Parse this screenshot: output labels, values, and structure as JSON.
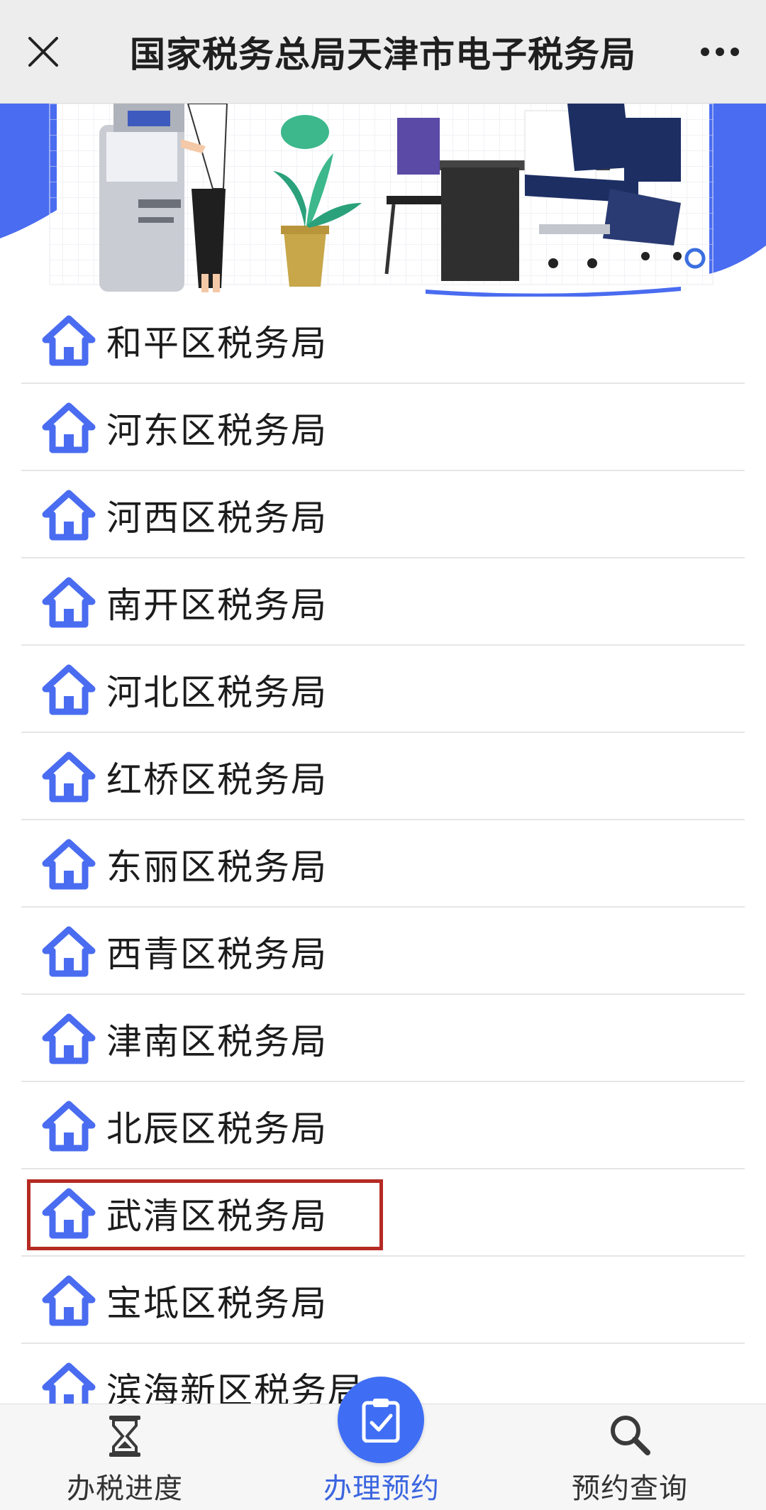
{
  "header": {
    "title": "国家税务总局天津市电子税务局",
    "close_icon": "close-icon",
    "more_icon": "more-dots-icon"
  },
  "banner": {
    "illustration": "tax-office-illustration"
  },
  "offices": [
    {
      "label": "和平区税务局"
    },
    {
      "label": "河东区税务局"
    },
    {
      "label": "河西区税务局"
    },
    {
      "label": "南开区税务局"
    },
    {
      "label": "河北区税务局"
    },
    {
      "label": "红桥区税务局"
    },
    {
      "label": "东丽区税务局"
    },
    {
      "label": "西青区税务局"
    },
    {
      "label": "津南区税务局"
    },
    {
      "label": "北辰区税务局"
    },
    {
      "label": "武清区税务局"
    },
    {
      "label": "宝坻区税务局"
    },
    {
      "label": "滨海新区税务局"
    }
  ],
  "highlighted_office": "武清区税务局",
  "bottom_nav": {
    "progress": {
      "label": "办税进度",
      "icon": "hourglass-icon"
    },
    "appointment": {
      "label": "办理预约",
      "icon": "clipboard-check-icon"
    },
    "query": {
      "label": "预约查询",
      "icon": "search-icon"
    }
  },
  "colors": {
    "accent": "#3f6ef5",
    "home_icon": "#4a6cf0",
    "highlight_border": "#b52a23",
    "active_tab": "#3b66e0"
  }
}
